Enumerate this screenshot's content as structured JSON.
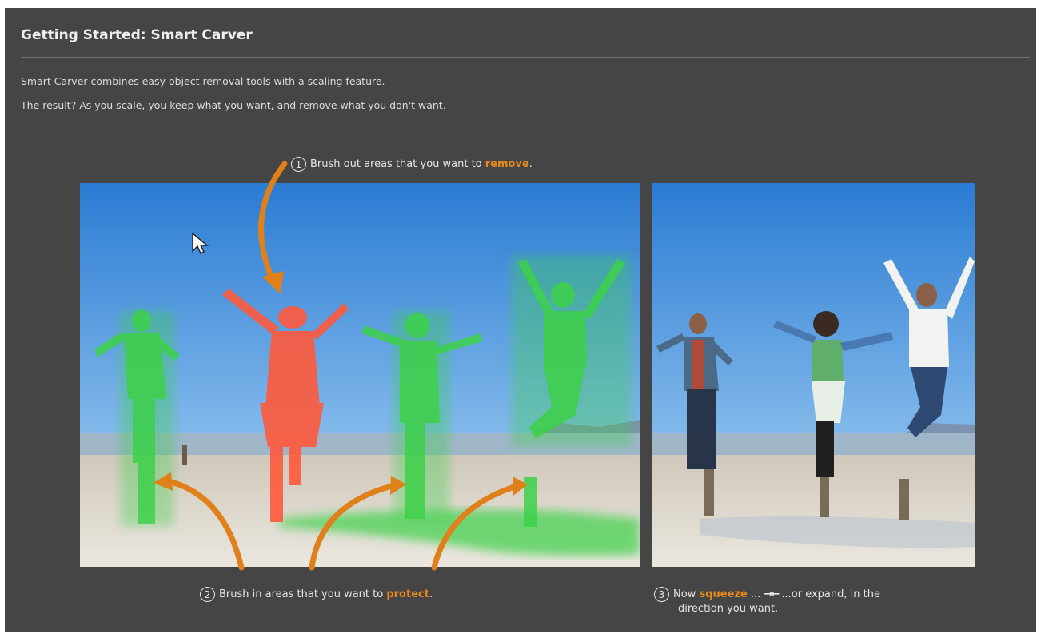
{
  "header": {
    "title": "Getting Started: Smart Carver",
    "intro_line1": "Smart Carver combines easy object removal tools with a scaling feature.",
    "intro_line2": "The result? As you scale, you keep what you want, and remove what you don't want."
  },
  "steps": [
    {
      "number": "1",
      "text": "Brush out areas that you want to ",
      "highlight": "remove",
      "suffix": "."
    },
    {
      "number": "2",
      "text": "Brush in areas that you want to ",
      "highlight": "protect",
      "suffix": "."
    },
    {
      "number": "3",
      "text_before": "Now ",
      "highlight": "squeeze",
      "text_after": " ... ",
      "arrows_glyph": "→←",
      "text_after2": " ...or expand, in the",
      "line2": "direction you want."
    }
  ],
  "icons": [
    "mouse-cursor-icon",
    "arrow-icon",
    "squeeze-arrows-icon"
  ],
  "colors": {
    "panel_bg": "#454545",
    "accent_orange": "#e88a1a",
    "remove_red": "#ff5a3c",
    "protect_green": "#38d24a",
    "sky_top": "#2c7fd6",
    "sand": "#d8d3c8"
  }
}
